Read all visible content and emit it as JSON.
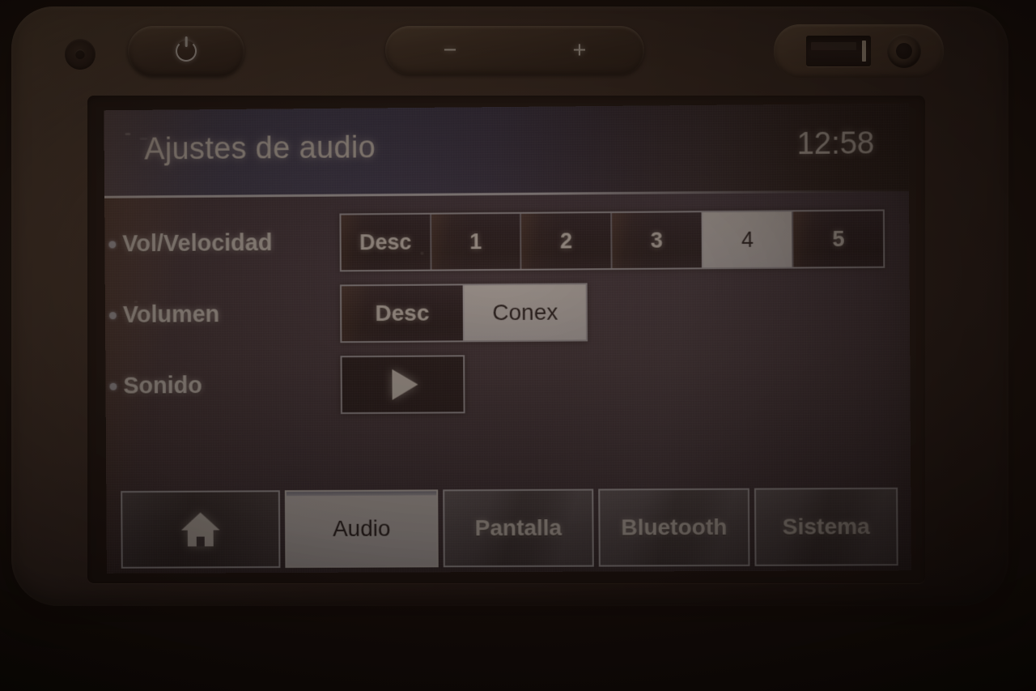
{
  "device": {
    "hardware": {
      "sensor": "ir-sensor",
      "power_button": "power-button",
      "volume_down": "−",
      "volume_up": "+",
      "usb_port": "usb-port",
      "aux_port": "aux-jack"
    }
  },
  "screen": {
    "header": {
      "title": "Ajustes de audio",
      "clock": "12:58"
    },
    "settings": [
      {
        "label": "Vol/Velocidad",
        "control": "segmented",
        "options": [
          "Desc",
          "1",
          "2",
          "3",
          "4",
          "5"
        ],
        "selected": "4",
        "selected_index": 4
      },
      {
        "label": "Volumen",
        "control": "toggle",
        "options": [
          "Desc",
          "Conex"
        ],
        "selected": "Conex",
        "selected_index": 1
      },
      {
        "label": "Sonido",
        "control": "button",
        "icon": "play-icon"
      }
    ],
    "tabs": [
      {
        "label": "",
        "icon": "home-icon",
        "selected": false
      },
      {
        "label": "Audio",
        "icon": "",
        "selected": true
      },
      {
        "label": "Pantalla",
        "icon": "",
        "selected": false
      },
      {
        "label": "Bluetooth",
        "icon": "",
        "selected": false
      },
      {
        "label": "Sistema",
        "icon": "",
        "selected": false
      }
    ]
  },
  "colors": {
    "selected_bg": "#f7f8fb",
    "selected_fg": "#14121a",
    "screen_bg": "#3d3549",
    "header_bg": "#34385c",
    "text": "#fdf9f2",
    "bezel": "#3a2d24"
  }
}
